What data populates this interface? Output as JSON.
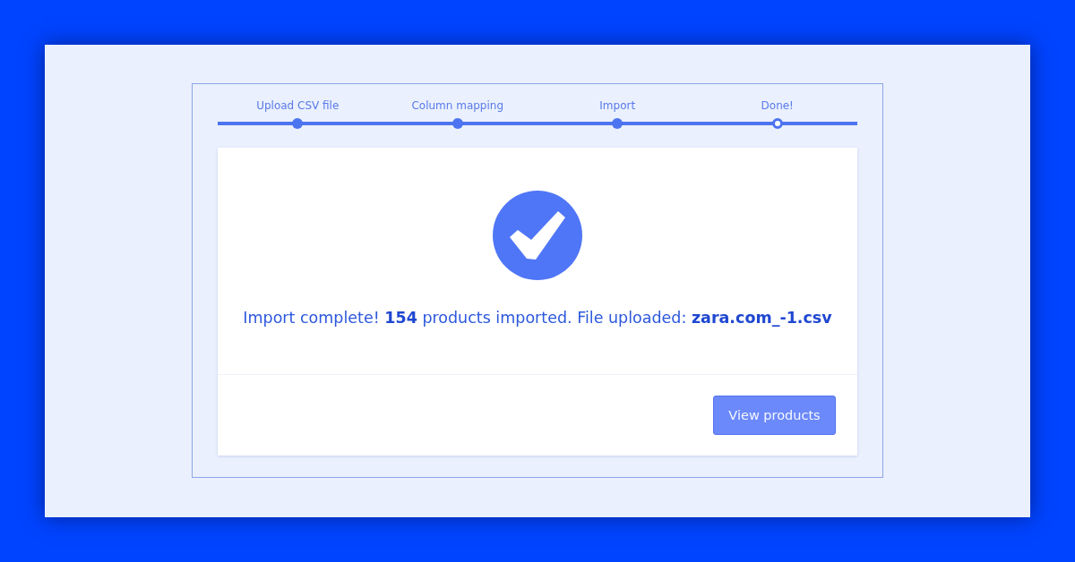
{
  "steps": [
    {
      "label": "Upload CSV file",
      "active": false
    },
    {
      "label": "Column mapping",
      "active": false
    },
    {
      "label": "Import",
      "active": false
    },
    {
      "label": "Done!",
      "active": true
    }
  ],
  "result": {
    "message": "Import complete! **154** products imported. File uploaded: **zara.com_-1.csv**"
  },
  "footer": {
    "button": "View products"
  }
}
